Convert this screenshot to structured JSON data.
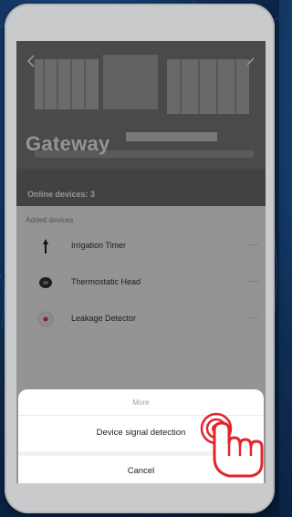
{
  "header": {
    "title": "Gateway",
    "online_devices": "Online devices: 3",
    "back_icon": "arrow-left-icon",
    "edit_icon": "pencil-icon"
  },
  "devices_section": {
    "title": "Added devices",
    "items": [
      {
        "name": "Irrigation Timer",
        "icon": "irrigation-timer-icon"
      },
      {
        "name": "Thermostatic Head",
        "icon": "thermostat-icon"
      },
      {
        "name": "Leakage Detector",
        "icon": "leak-detector-icon"
      }
    ]
  },
  "action_sheet": {
    "title": "More",
    "option": "Device signal detection",
    "cancel": "Cancel"
  },
  "colors": {
    "background": "#0f2f57",
    "device_frame": "#c9cacb",
    "hand_accent": "#e2252b"
  }
}
